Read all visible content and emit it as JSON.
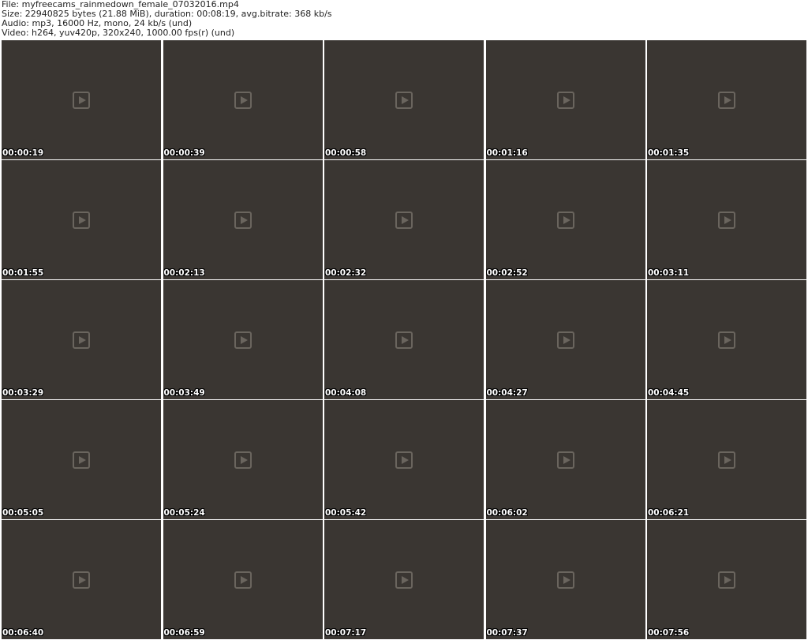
{
  "header": {
    "file_line": "File: myfreecams_rainmedown_female_07032016.mp4",
    "size_line": "Size: 22940825 bytes (21.88 MiB), duration: 00:08:19, avg.bitrate: 368 kb/s",
    "audio_line": "Audio: mp3, 16000 Hz, mono, 24 kb/s (und)",
    "video_line": "Video: h264, yuv420p, 320x240, 1000.00 fps(r) (und)"
  },
  "frames": [
    {
      "timestamp": "00:00:19"
    },
    {
      "timestamp": "00:00:39"
    },
    {
      "timestamp": "00:00:58"
    },
    {
      "timestamp": "00:01:16"
    },
    {
      "timestamp": "00:01:35"
    },
    {
      "timestamp": "00:01:55"
    },
    {
      "timestamp": "00:02:13"
    },
    {
      "timestamp": "00:02:32"
    },
    {
      "timestamp": "00:02:52"
    },
    {
      "timestamp": "00:03:11"
    },
    {
      "timestamp": "00:03:29"
    },
    {
      "timestamp": "00:03:49"
    },
    {
      "timestamp": "00:04:08"
    },
    {
      "timestamp": "00:04:27"
    },
    {
      "timestamp": "00:04:45"
    },
    {
      "timestamp": "00:05:05"
    },
    {
      "timestamp": "00:05:24"
    },
    {
      "timestamp": "00:05:42"
    },
    {
      "timestamp": "00:06:02"
    },
    {
      "timestamp": "00:06:21"
    },
    {
      "timestamp": "00:06:40"
    },
    {
      "timestamp": "00:06:59"
    },
    {
      "timestamp": "00:07:17"
    },
    {
      "timestamp": "00:07:37"
    },
    {
      "timestamp": "00:07:56"
    }
  ]
}
